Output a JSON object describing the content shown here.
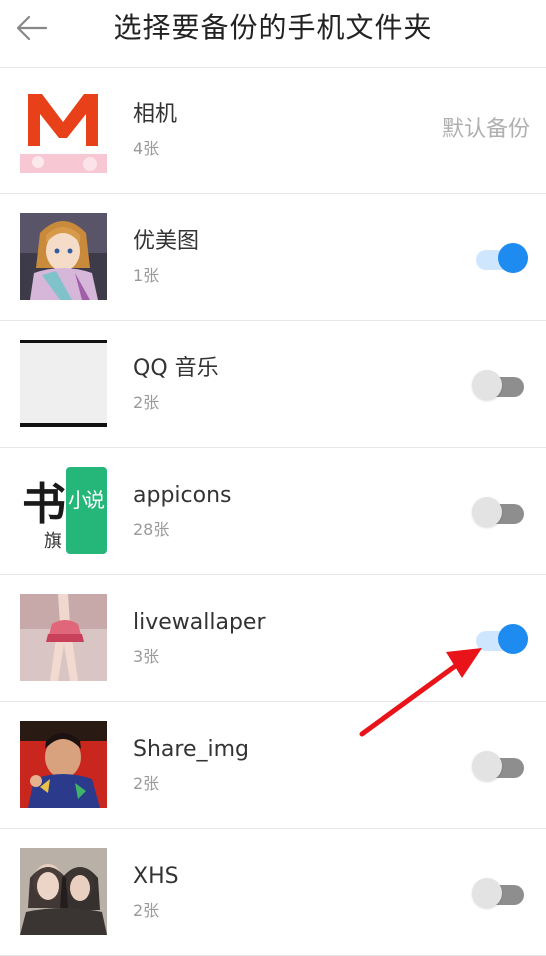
{
  "header": {
    "title": "选择要备份的手机文件夹",
    "back_icon": "arrow-left-icon"
  },
  "folders": [
    {
      "name": "相机",
      "count": "4张",
      "status": "默认备份",
      "enabled": true,
      "icon": "camera-folder-thumb"
    },
    {
      "name": "优美图",
      "count": "1张",
      "enabled": true,
      "icon": "anime-girl-thumb"
    },
    {
      "name": "QQ 音乐",
      "count": "2张",
      "enabled": false,
      "icon": "blank-image-thumb"
    },
    {
      "name": "appicons",
      "count": "28张",
      "enabled": false,
      "icon": "book-app-thumb"
    },
    {
      "name": "livewallaper",
      "count": "3张",
      "enabled": true,
      "icon": "wallpaper-thumb"
    },
    {
      "name": "Share_img",
      "count": "2张",
      "enabled": false,
      "icon": "meme-thumb"
    },
    {
      "name": "XHS",
      "count": "2张",
      "enabled": false,
      "icon": "photo-thumb"
    }
  ],
  "thumb_text": {
    "appicons_left": "书",
    "appicons_small": "旗",
    "appicons_right": "小说"
  },
  "colors": {
    "toggle_on": "#1e8bf0",
    "toggle_on_track": "#cfe6ff",
    "toggle_off_track": "#8e8e8e",
    "annotation_arrow": "#e8141a"
  }
}
